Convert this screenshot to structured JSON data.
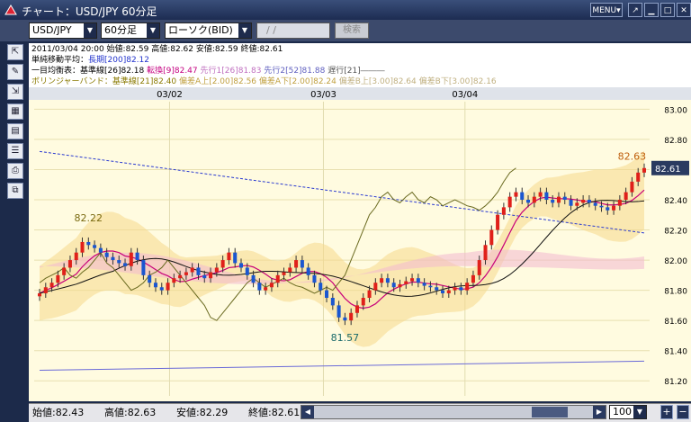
{
  "window": {
    "title": "チャート：USD/JPY 60分足",
    "menu_label": "MENU▾",
    "btn_pin": "↗",
    "btn_min": "▁",
    "btn_max": "□",
    "btn_close": "✕"
  },
  "toolbar": {
    "pair": "USD/JPY",
    "timeframe": "60分足",
    "chart_type": "ローソク(BID)",
    "date": "  /  /",
    "search": "検索"
  },
  "left_tools": [
    "⇱",
    "✎",
    "⇲",
    "▦",
    "▤",
    "☰",
    "⎙",
    "⧉"
  ],
  "info": {
    "line1": "2011/03/04 20:00 始値:82.59 高値:82.62 安値:82.59 終値:82.61",
    "line2_label": "単純移動平均：",
    "line2_a": "長期[200]82.12",
    "line3_label": "一目均衡表：基準線[26]82.18",
    "line3_b": "転換[9]82.47",
    "line3_c": "先行1[26]81.83",
    "line3_d": "先行2[52]81.88",
    "line3_e": "遅行[21]―――",
    "line4_label": "ボリンジャーバンド：基準線[21]82.40",
    "line4_b": "偏差A上[2.00]82.56",
    "line4_c": "偏差A下[2.00]82.24",
    "line4_d": "偏差B上[3.00]82.64",
    "line4_e": "偏差B下[3.00]82.16"
  },
  "chart_data": {
    "type": "candlestick",
    "x_labels": [
      "03/02",
      "03/03",
      "03/04"
    ],
    "y_ticks": [
      "83.00",
      "82.80",
      "82.60",
      "82.40",
      "82.20",
      "82.00",
      "81.80",
      "81.60",
      "81.40",
      "81.20"
    ],
    "ylim": [
      81.1,
      83.05
    ],
    "current_price": "82.61",
    "annotations": {
      "high_left": "82.22",
      "low": "81.57",
      "high_right": "82.63"
    },
    "close": [
      81.78,
      81.82,
      81.85,
      81.9,
      81.95,
      82.0,
      82.05,
      82.12,
      82.1,
      82.08,
      82.05,
      82.02,
      82.0,
      81.98,
      81.96,
      82.05,
      82.0,
      81.9,
      81.85,
      81.82,
      81.8,
      81.85,
      81.88,
      81.9,
      81.92,
      81.95,
      81.9,
      81.88,
      81.92,
      81.95,
      82.0,
      82.05,
      81.98,
      81.95,
      81.9,
      81.85,
      81.8,
      81.82,
      81.85,
      81.9,
      81.92,
      81.95,
      82.0,
      81.95,
      81.9,
      81.85,
      81.8,
      81.75,
      81.7,
      81.62,
      81.6,
      81.65,
      81.7,
      81.75,
      81.8,
      81.85,
      81.88,
      81.85,
      81.82,
      81.84,
      81.86,
      81.88,
      81.85,
      81.83,
      81.82,
      81.8,
      81.78,
      81.8,
      81.82,
      81.8,
      81.85,
      81.9,
      82.0,
      82.1,
      82.2,
      82.3,
      82.35,
      82.42,
      82.45,
      82.4,
      82.38,
      82.42,
      82.45,
      82.4,
      82.38,
      82.42,
      82.4,
      82.36,
      82.38,
      82.4,
      82.38,
      82.36,
      82.35,
      82.33,
      82.36,
      82.4,
      82.45,
      82.52,
      82.58,
      82.61
    ]
  },
  "status": {
    "open": "始値:82.43",
    "high": "高値:82.63",
    "low": "安値:82.29",
    "close": "終値:82.61",
    "zoom": "100"
  }
}
